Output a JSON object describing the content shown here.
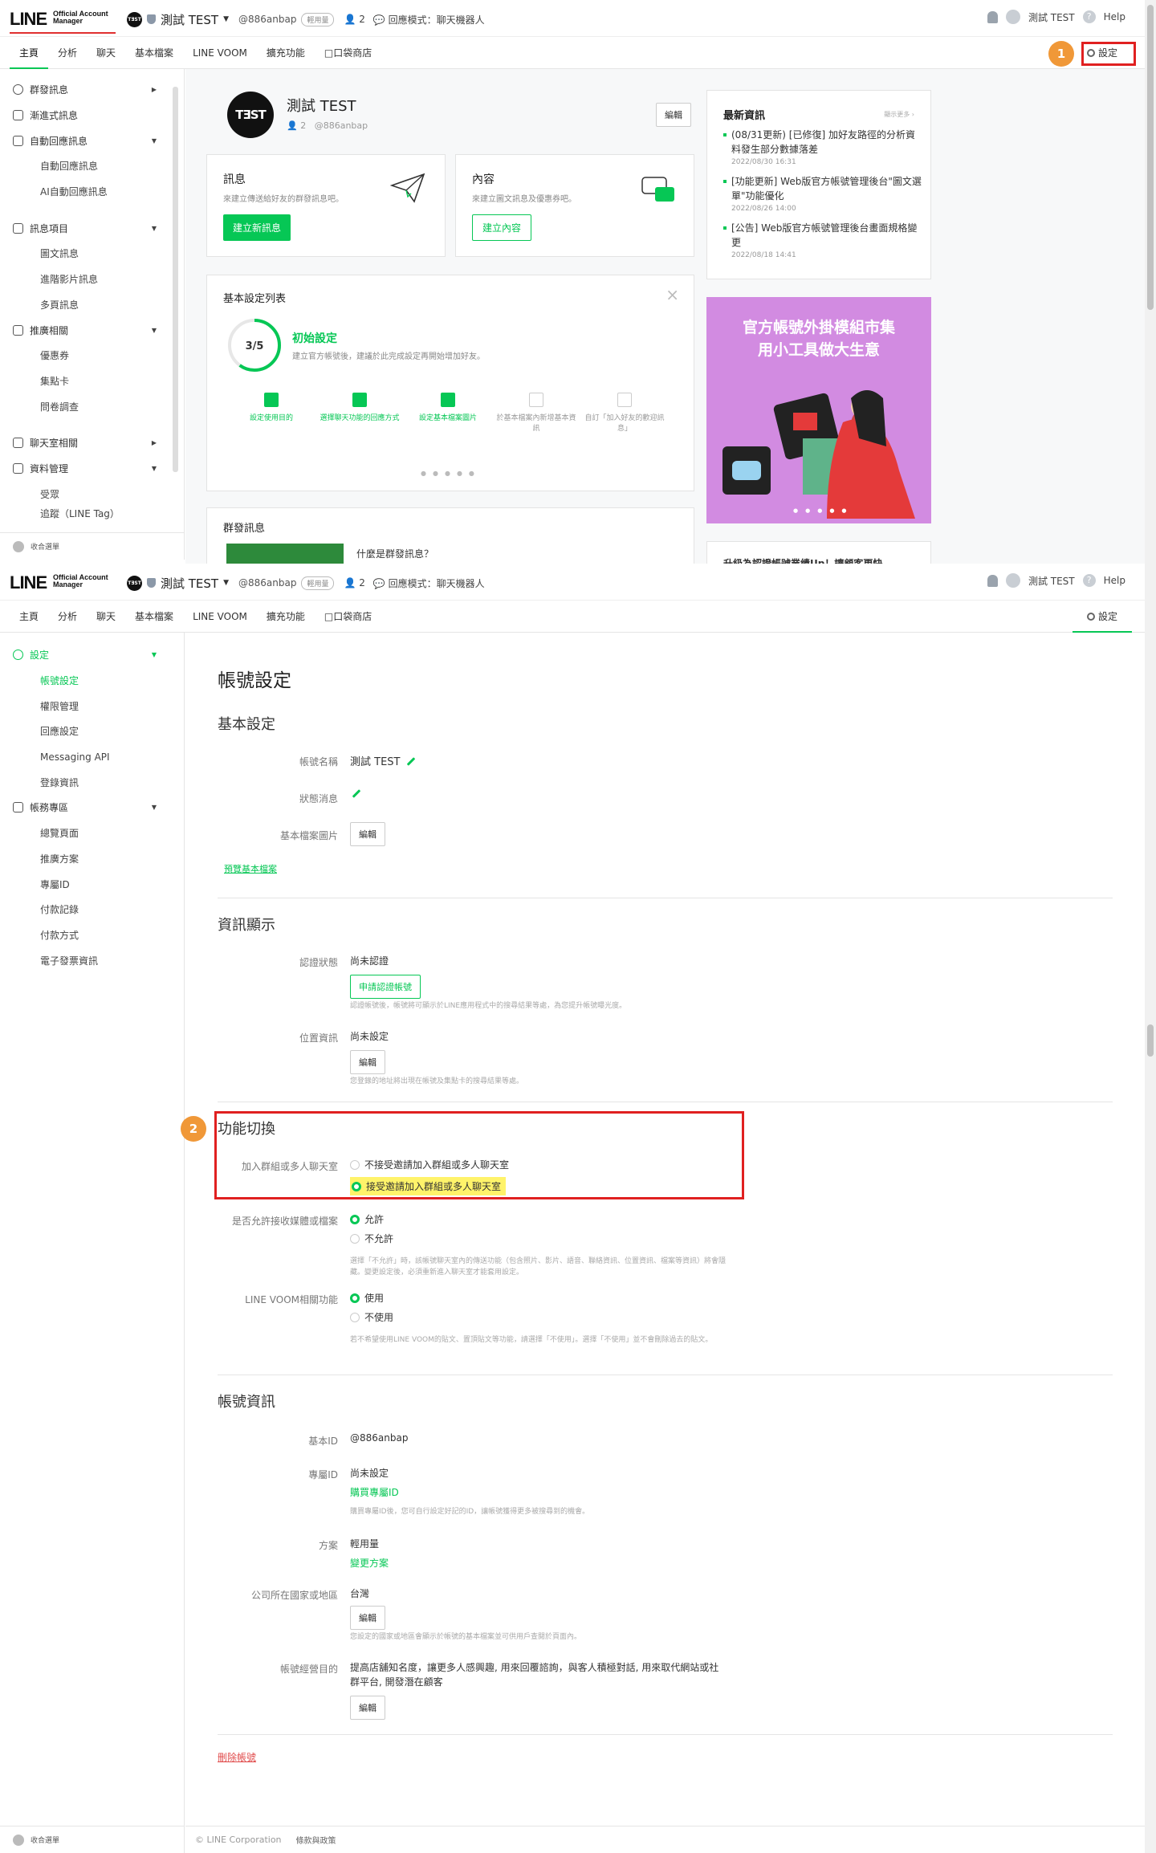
{
  "header": {
    "logo_main": "LINE",
    "logo_sub_1": "Official Account",
    "logo_sub_2": "Manager",
    "account_avatar_text": "TƎST",
    "account_name": "測試 TEST",
    "account_id": "@886anbap",
    "plan_badge": "輕用量",
    "friends_count": "2",
    "response_mode": "回應模式：聊天機器人",
    "user_name": "測試 TEST",
    "help": "Help"
  },
  "nav": {
    "tabs": [
      "主頁",
      "分析",
      "聊天",
      "基本檔案",
      "LINE VOOM",
      "擴充功能",
      "口袋商店"
    ],
    "settings": "設定"
  },
  "annotations": {
    "step1": "1",
    "step2": "2"
  },
  "sidebar_home": {
    "items": [
      {
        "label": "群發訊息",
        "icon": "broadcast-icon",
        "arrow": "▶"
      },
      {
        "label": "漸進式訊息",
        "icon": "hierarchy-icon",
        "arrow": ""
      },
      {
        "label": "自動回應訊息",
        "icon": "reply-icon",
        "arrow": "▼"
      },
      {
        "label": "自動回應訊息",
        "sub": true
      },
      {
        "label": "AI自動回應訊息",
        "sub": true
      },
      {
        "label": "訊息項目",
        "icon": "message-icon",
        "arrow": "▼"
      },
      {
        "label": "圖文訊息",
        "sub": true
      },
      {
        "label": "進階影片訊息",
        "sub": true
      },
      {
        "label": "多頁訊息",
        "sub": true
      },
      {
        "label": "推廣相關",
        "icon": "shop-icon",
        "arrow": "▼"
      },
      {
        "label": "優惠券",
        "sub": true
      },
      {
        "label": "集點卡",
        "sub": true
      },
      {
        "label": "問卷調查",
        "sub": true
      },
      {
        "label": "聊天室相關",
        "icon": "chat-room-icon",
        "arrow": "▶"
      },
      {
        "label": "資料管理",
        "icon": "database-icon",
        "arrow": "▼"
      },
      {
        "label": "受眾",
        "sub": true
      },
      {
        "label": "追蹤（LINE Tag）",
        "sub": true
      }
    ],
    "collapse": "收合選單"
  },
  "home": {
    "profile": {
      "avatar_text": "TƎST",
      "name": "測試 TEST",
      "friends": "2",
      "id": "@886anbap",
      "edit": "編輯"
    },
    "message_box": {
      "title": "訊息",
      "desc": "來建立傳送給好友的群發訊息吧。",
      "button": "建立新訊息"
    },
    "content_box": {
      "title": "內容",
      "desc": "來建立圖文訊息及優惠券吧。",
      "button": "建立內容"
    },
    "setup": {
      "title": "基本設定列表",
      "progress": "3/5",
      "progress_fraction": 0.6,
      "heading": "初始設定",
      "desc": "建立官方帳號後，建議於此完成設定再開始增加好友。",
      "steps": [
        {
          "label": "設定使用目的",
          "done": true
        },
        {
          "label": "選擇聊天功能的回應方式",
          "done": true
        },
        {
          "label": "設定基本檔案圖片",
          "done": true
        },
        {
          "label": "於基本檔案內新增基本資訊",
          "done": false
        },
        {
          "label": "自訂「加入好友的歡迎訊息」",
          "done": false
        }
      ]
    },
    "broadcast_card": {
      "title": "群發訊息",
      "question": "什麼是群發訊息？"
    },
    "news": {
      "title": "最新資訊",
      "more": "顯示更多",
      "items": [
        {
          "text": "(08/31更新) [已修復] 加好友路徑的分析資料發生部分數據落差",
          "date": "2022/08/30 16:31"
        },
        {
          "text": "[功能更新] Web版官方帳號管理後台\"圖文選單\"功能優化",
          "date": "2022/08/26 14:00"
        },
        {
          "text": "[公告] Web版官方帳號管理後台畫面規格變更",
          "date": "2022/08/18 14:41"
        }
      ]
    },
    "banner": {
      "line1": "官方帳號外掛模組市集",
      "line2": "用小工具做大生意"
    },
    "upgrade_card": "升級為認證帳號業績Up！讓顧客更快"
  },
  "sidebar_settings": {
    "items": [
      {
        "label": "設定",
        "icon": "gear-icon",
        "arrow": "▼",
        "active": true
      },
      {
        "label": "帳號設定",
        "sub": true,
        "current": true
      },
      {
        "label": "權限管理",
        "sub": true
      },
      {
        "label": "回應設定",
        "sub": true
      },
      {
        "label": "Messaging API",
        "sub": true
      },
      {
        "label": "登錄資訊",
        "sub": true
      },
      {
        "label": "帳務專區",
        "icon": "billing-icon",
        "arrow": "▼"
      },
      {
        "label": "總覽頁面",
        "sub": true
      },
      {
        "label": "推廣方案",
        "sub": true
      },
      {
        "label": "專屬ID",
        "sub": true
      },
      {
        "label": "付款記錄",
        "sub": true
      },
      {
        "label": "付款方式",
        "sub": true
      },
      {
        "label": "電子發票資訊",
        "sub": true
      }
    ],
    "collapse": "收合選單"
  },
  "account_settings": {
    "title": "帳號設定",
    "basic": {
      "title": "基本設定",
      "name_label": "帳號名稱",
      "name_value": "測試 TEST",
      "status_label": "狀態消息",
      "image_label": "基本檔案圖片",
      "edit": "編輯",
      "preview_link": "預覽基本檔案"
    },
    "display": {
      "title": "資訊顯示",
      "verify_label": "認證狀態",
      "verify_value": "尚未認證",
      "verify_button": "申請認證帳號",
      "verify_note": "認證帳號後，帳號將可顯示於LINE應用程式中的搜尋結果等處，為您提升帳號曝光度。",
      "location_label": "位置資訊",
      "location_value": "尚未設定",
      "edit": "編輯",
      "location_note": "您登錄的地址將出現在帳號及集點卡的搜尋結果等處。"
    },
    "toggles": {
      "title": "功能切換",
      "group_label": "加入群組或多人聊天室",
      "group_opt1": "不接受邀請加入群組或多人聊天室",
      "group_opt2": "接受邀請加入群組或多人聊天室",
      "media_label": "是否允許接收媒體或檔案",
      "media_opt1": "允許",
      "media_opt2": "不允許",
      "media_note": "選擇「不允許」時，該帳號聊天室內的傳送功能（包含照片、影片、語音、聯絡資訊、位置資訊、檔案等資訊）將會隱藏。變更設定後，必須重新進入聊天室才能套用設定。",
      "voom_label": "LINE VOOM相關功能",
      "voom_opt1": "使用",
      "voom_opt2": "不使用",
      "voom_note": "若不希望使用LINE VOOM的貼文、置頂貼文等功能，請選擇「不使用」。選擇「不使用」並不會刪除過去的貼文。"
    },
    "info": {
      "title": "帳號資訊",
      "basic_id_label": "基本ID",
      "basic_id_value": "@886anbap",
      "premium_id_label": "專屬ID",
      "premium_id_value": "尚未設定",
      "premium_id_link": "購買專屬ID",
      "premium_id_note": "購買專屬ID後，您可自行設定好記的ID，讓帳號獲得更多被搜尋到的機會。",
      "plan_label": "方案",
      "plan_value": "輕用量",
      "plan_link": "變更方案",
      "country_label": "公司所在國家或地區",
      "country_value": "台灣",
      "country_note": "您設定的國家或地區會顯示於帳號的基本檔案並可供用戶查閱於頁面內。",
      "purpose_label": "帳號經營目的",
      "purpose_value_1": "提高店舖知名度，讓更多人感興趣, 用來回覆諮詢，與客人積極對話, 用來取代網站或社",
      "purpose_value_2": "群平台, 開發潛在顧客",
      "edit": "編輯",
      "delete_link": "刪除帳號"
    }
  },
  "footer": {
    "copyright": "© LINE Corporation",
    "terms": "條款與政策"
  }
}
